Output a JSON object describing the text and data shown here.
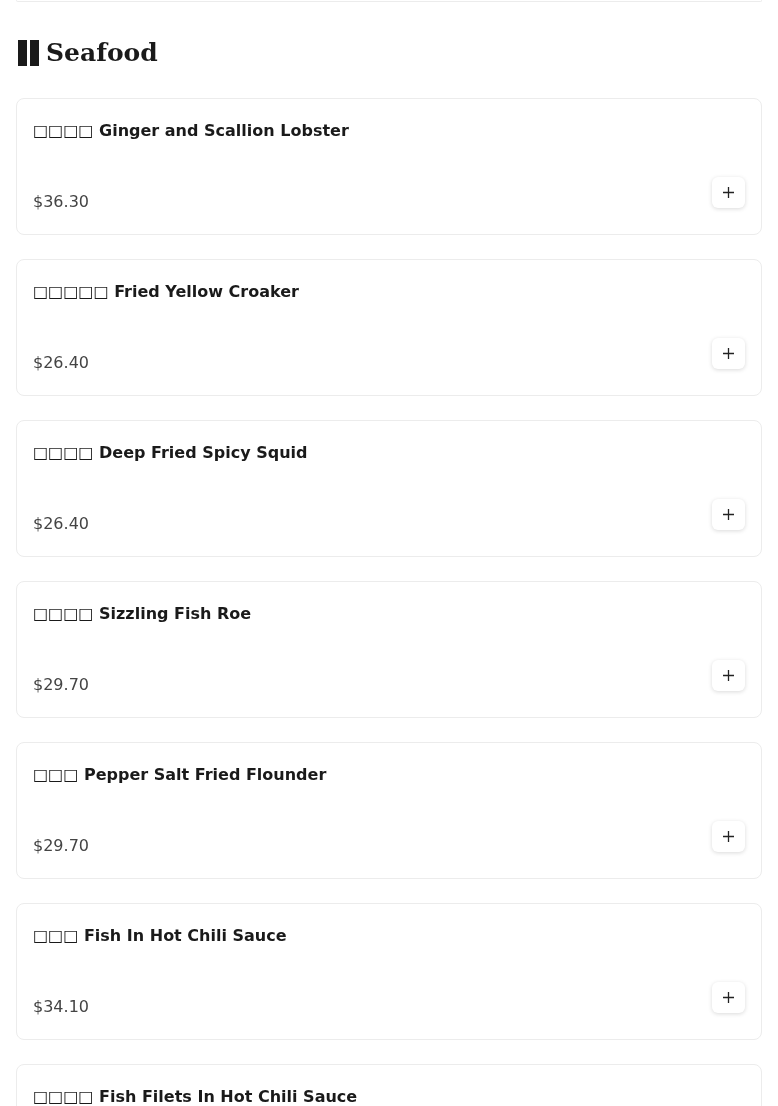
{
  "section": {
    "title": "Seafood"
  },
  "items": [
    {
      "name": "□□□□ Ginger and Scallion Lobster",
      "price": "$36.30"
    },
    {
      "name": "□□□□□ Fried Yellow Croaker",
      "price": "$26.40"
    },
    {
      "name": "□□□□ Deep Fried Spicy Squid",
      "price": "$26.40"
    },
    {
      "name": "□□□□ Sizzling Fish Roe",
      "price": "$29.70"
    },
    {
      "name": "□□□ Pepper Salt Fried Flounder",
      "price": "$29.70"
    },
    {
      "name": "□□□ Fish In Hot Chili Sauce",
      "price": "$34.10"
    },
    {
      "name": "□□□□ Fish Filets In Hot Chili Sauce"
    }
  ]
}
